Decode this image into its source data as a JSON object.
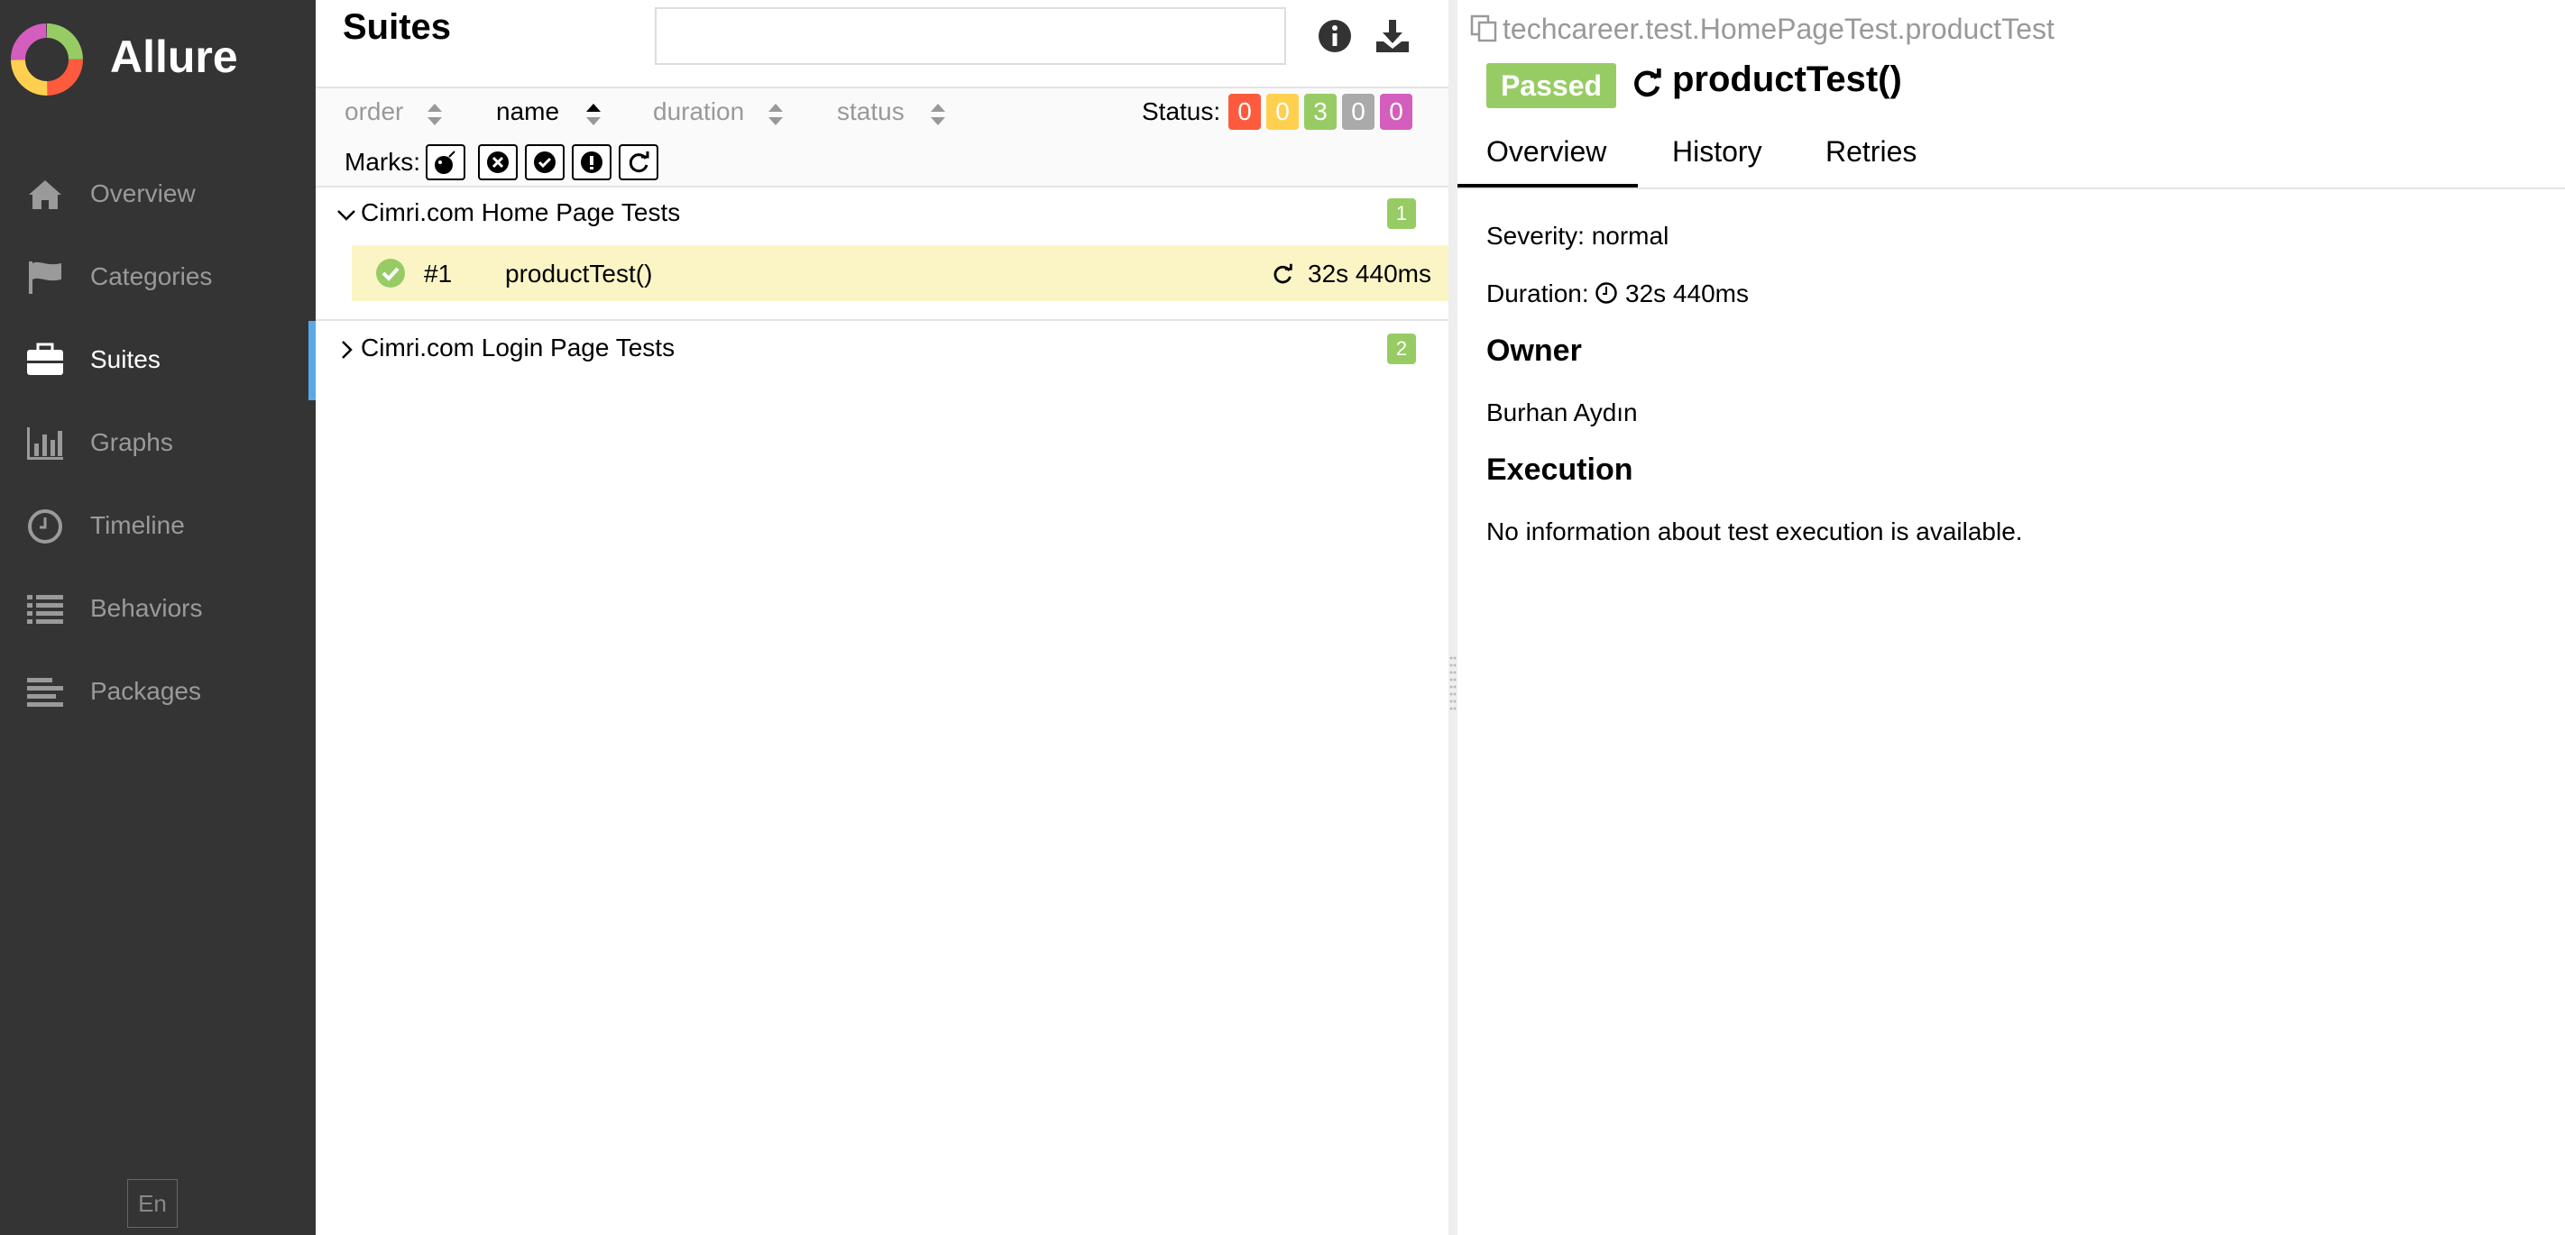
{
  "app": {
    "brand": "Allure",
    "language": "En"
  },
  "sidebar": {
    "items": [
      {
        "label": "Overview",
        "icon": "home-icon"
      },
      {
        "label": "Categories",
        "icon": "flag-icon"
      },
      {
        "label": "Suites",
        "icon": "briefcase-icon",
        "active": true
      },
      {
        "label": "Graphs",
        "icon": "bar-chart-icon"
      },
      {
        "label": "Timeline",
        "icon": "clock-icon"
      },
      {
        "label": "Behaviors",
        "icon": "list-icon"
      },
      {
        "label": "Packages",
        "icon": "align-left-icon"
      }
    ]
  },
  "suites": {
    "title": "Suites",
    "search": {
      "value": "",
      "placeholder": ""
    },
    "sort": {
      "order": "order",
      "name": "name",
      "duration": "duration",
      "status": "status"
    },
    "status_label": "Status:",
    "status_counts": [
      {
        "value": "0",
        "color": "#fd5a3e"
      },
      {
        "value": "0",
        "color": "#ffd050"
      },
      {
        "value": "3",
        "color": "#97cc64"
      },
      {
        "value": "0",
        "color": "#aaaaaa"
      },
      {
        "value": "0",
        "color": "#d35ebe"
      }
    ],
    "marks_label": "Marks:",
    "groups": [
      {
        "name": "Cimri.com Home Page Tests",
        "count": "1",
        "expanded": true
      },
      {
        "name": "Cimri.com Login Page Tests",
        "count": "2",
        "expanded": false
      }
    ],
    "test_row": {
      "number": "#1",
      "name": "productTest()",
      "duration": "32s 440ms"
    }
  },
  "details": {
    "full_name": "techcareer.test.HomePageTest.productTest",
    "status": "Passed",
    "title": "productTest()",
    "tabs": [
      "Overview",
      "History",
      "Retries"
    ],
    "severity": "Severity: normal",
    "duration_label": "Duration:",
    "duration": "32s 440ms",
    "owner_heading": "Owner",
    "owner": "Burhan Aydın",
    "execution_heading": "Execution",
    "execution_text": "No information about test execution is available."
  },
  "colors": {
    "sidebar": "#343434",
    "passed": "#97cc64",
    "active_indicator": "#5aa9e6",
    "selected_row": "#fbf5c6"
  }
}
